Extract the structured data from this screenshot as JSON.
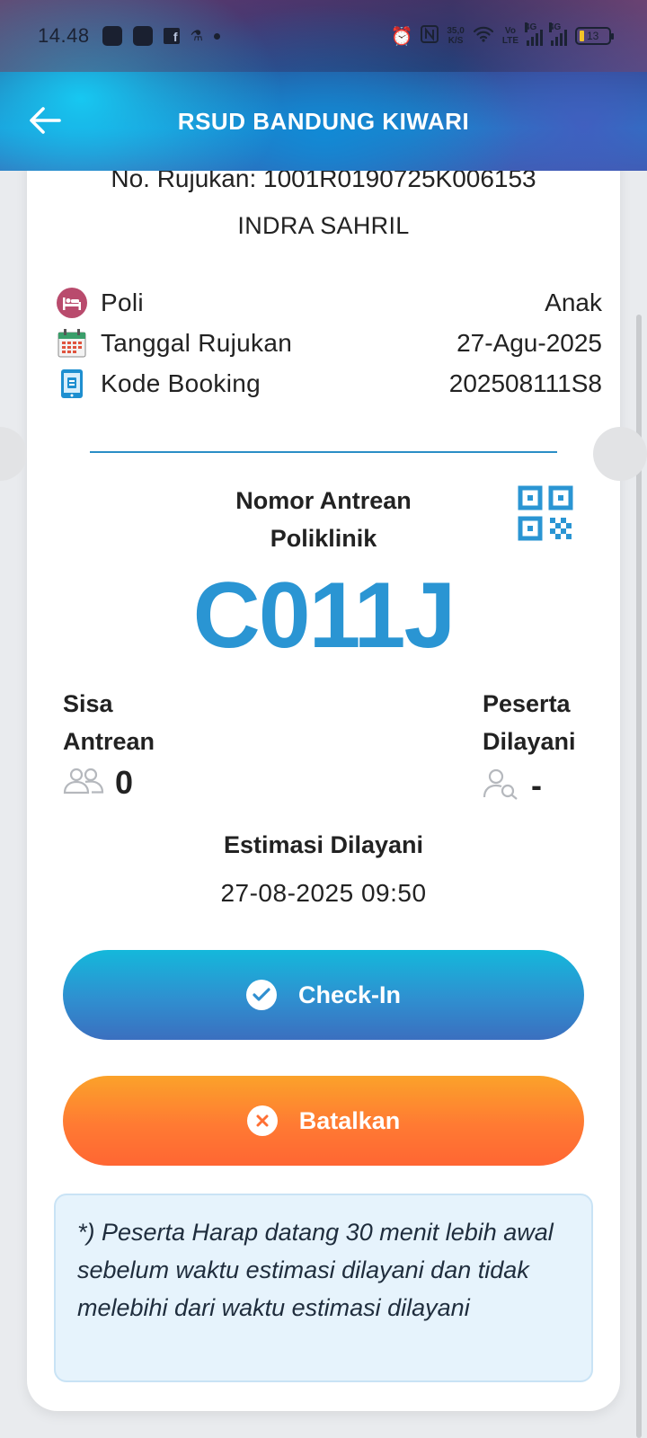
{
  "status_bar": {
    "time": "14.48",
    "net_speed_value": "35,0",
    "net_speed_unit": "K/S",
    "volte_top": "Vo",
    "volte_bottom": "LTE",
    "sim1": "4G",
    "sim2": "4G",
    "battery": "13"
  },
  "header": {
    "title": "RSUD BANDUNG KIWARI"
  },
  "ticket": {
    "rujukan": "No. Rujukan: 1001R0190725K006153",
    "patient_name": "INDRA SAHRIL",
    "rows": [
      {
        "label": "Poli",
        "value": "Anak"
      },
      {
        "label": "Tanggal Rujukan",
        "value": "27-Agu-2025"
      },
      {
        "label": "Kode Booking",
        "value": "202508111S8"
      }
    ],
    "queue_title_line1": "Nomor Antrean",
    "queue_title_line2": "Poliklinik",
    "queue_number": "C011J",
    "sisa_label_line1": "Sisa",
    "sisa_label_line2": "Antrean",
    "sisa_value": "0",
    "peserta_label_line1": "Peserta",
    "peserta_label_line2": "Dilayani",
    "peserta_value": "-",
    "estimasi_label": "Estimasi Dilayani",
    "estimasi_value": "27-08-2025 09:50"
  },
  "actions": {
    "checkin_label": "Check-In",
    "cancel_label": "Batalkan"
  },
  "note": {
    "text": "*) Peserta Harap datang 30 menit lebih awal sebelum waktu estimasi dilayani dan tidak melebihi dari waktu estimasi dilayani"
  },
  "colors": {
    "accent": "#2a95d3",
    "checkin": "#2f8fd0",
    "cancel": "#ff7a33",
    "note_bg": "#e6f3fc"
  },
  "icons": {
    "back": "arrow-left-icon",
    "poli": "hospital-bed-icon",
    "tanggal": "calendar-icon",
    "booking": "booking-phone-icon",
    "qr": "qr-code-icon",
    "sisa": "people-icon",
    "peserta": "user-search-icon",
    "checkin": "check-circle-icon",
    "cancel": "x-circle-icon"
  }
}
